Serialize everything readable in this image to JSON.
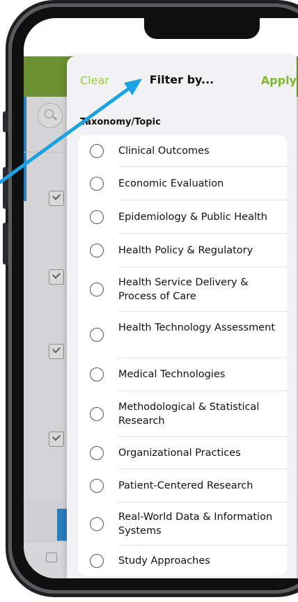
{
  "popover": {
    "clear_label": "Clear",
    "title": "Filter by...",
    "apply_label": "Apply",
    "section_label": "Taxonomy/Topic",
    "options": [
      "Clinical Outcomes",
      "Economic Evaluation",
      "Epidemiology & Public Health",
      "Health Policy & Regulatory",
      "Health Service Delivery & Process of Care",
      "Health Technology Assessment",
      "Medical Technologies",
      "Methodological & Statistical Research",
      "Organizational Practices",
      "Patient-Centered Research",
      "Real-World Data & Information Systems",
      "Study Approaches"
    ]
  },
  "colors": {
    "header_green": "#7aa63a",
    "accent_green": "#7fb832",
    "arrow_blue": "#1aa3e0",
    "accent_blue": "#2f8fd6"
  },
  "icons": {
    "search": "search-icon",
    "checkbox": "checkbox-icon",
    "calendar": "calendar-icon",
    "radio": "radio-icon",
    "arrow": "annotation-arrow-icon"
  }
}
